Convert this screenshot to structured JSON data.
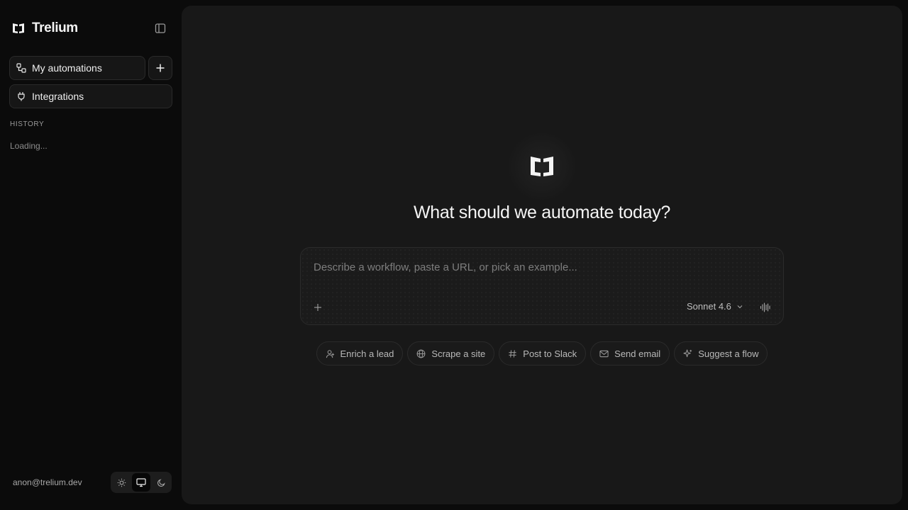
{
  "app": {
    "name": "Trelium"
  },
  "sidebar": {
    "nav": {
      "automations_label": "My automations",
      "integrations_label": "Integrations"
    },
    "history": {
      "label": "HISTORY",
      "status": "Loading..."
    },
    "user": {
      "email": "anon@trelium.dev"
    },
    "theme": {
      "options": [
        "light",
        "system",
        "dark"
      ],
      "selected": "system"
    }
  },
  "main": {
    "title": "What should we automate today?",
    "composer": {
      "placeholder": "Describe a workflow, paste a URL, or pick an example...",
      "model": "Sonnet 4.6"
    },
    "suggestions": [
      {
        "label": "Enrich a lead",
        "icon": "user-icon"
      },
      {
        "label": "Scrape a site",
        "icon": "globe-icon"
      },
      {
        "label": "Post to Slack",
        "icon": "hash-icon"
      },
      {
        "label": "Send email",
        "icon": "mail-icon"
      },
      {
        "label": "Suggest a flow",
        "icon": "sparkle-icon"
      }
    ]
  },
  "colors": {
    "sidebar_bg": "#0b0b0b",
    "panel_bg": "#181818",
    "border": "#2b2b2b",
    "text_primary": "#f5f5f5",
    "text_muted": "#9a9a9a"
  }
}
